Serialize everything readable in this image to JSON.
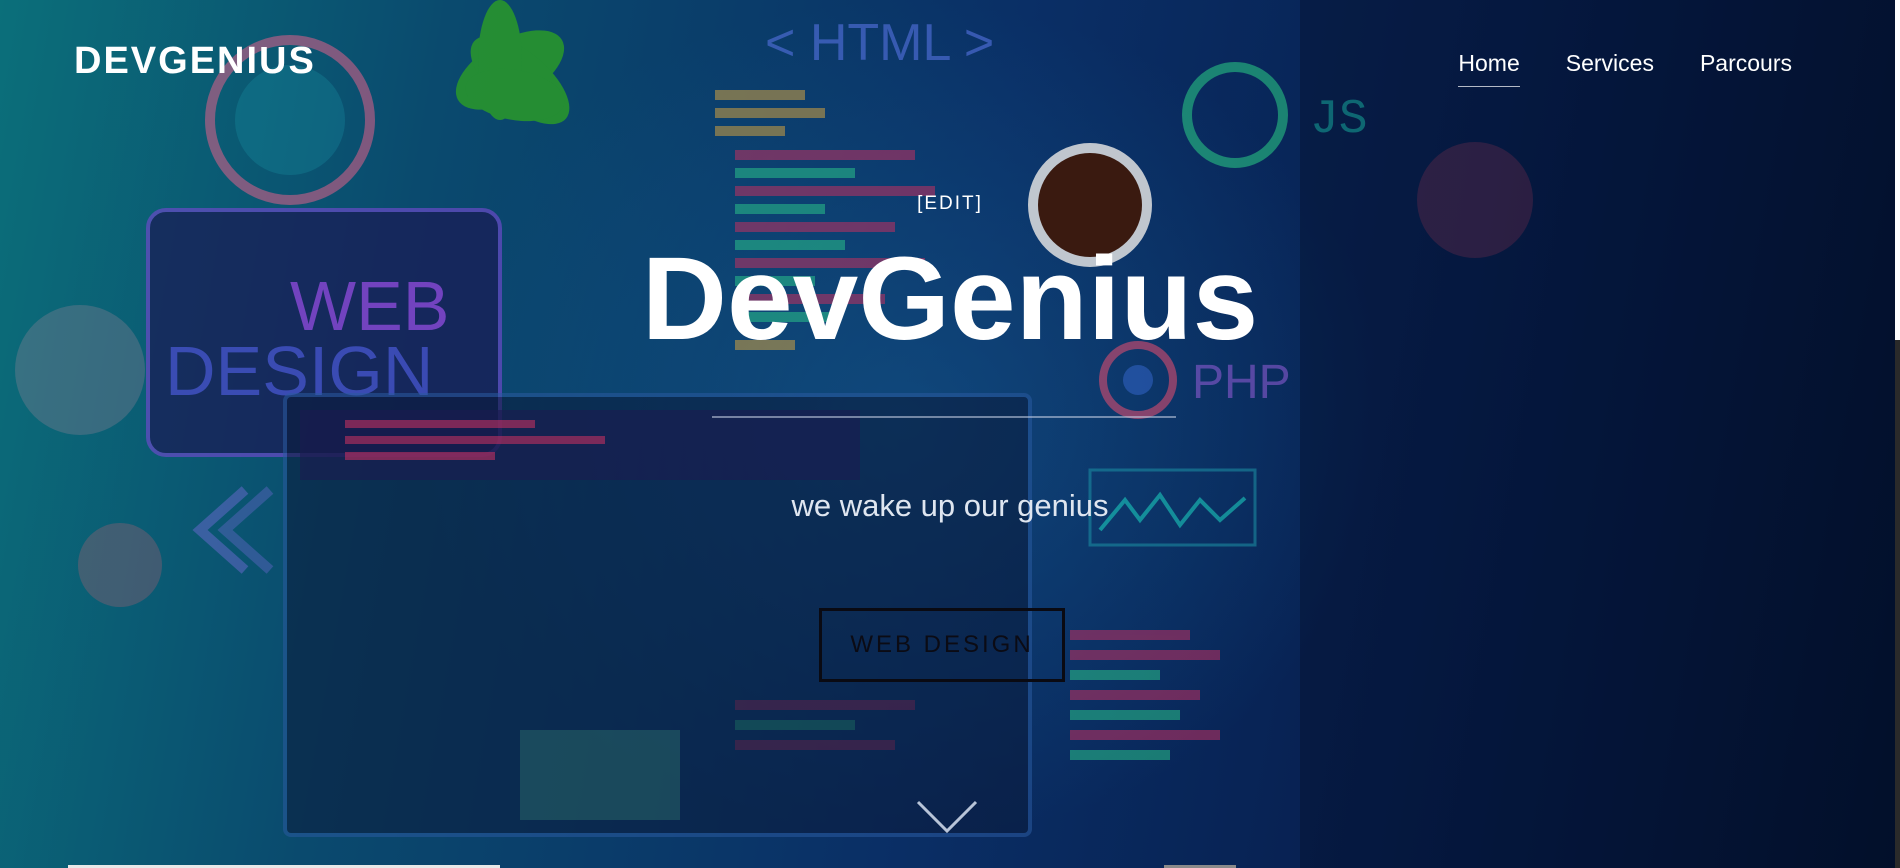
{
  "site": {
    "brand": "DEVGENIUS"
  },
  "nav": {
    "items": [
      {
        "label": "Home",
        "active": true
      },
      {
        "label": "Services",
        "active": false
      },
      {
        "label": "Parcours",
        "active": false
      }
    ]
  },
  "hero": {
    "edit_label": "[EDIT]",
    "title": "DevGenius",
    "subtitle": "we wake up our genius",
    "cta_label": "WEB DESIGN",
    "scroll_icon": "chevron-down-icon"
  },
  "background": {
    "decor_texts": [
      "HTML",
      "JS",
      "PHP",
      "WEB",
      "DESIGN"
    ]
  },
  "colors": {
    "text": "#ffffff",
    "subtitle": "#dfe6f0",
    "cta_border": "#0a0a12",
    "bg_dark": "#061a3a",
    "bg_teal": "#0b6f7a"
  }
}
